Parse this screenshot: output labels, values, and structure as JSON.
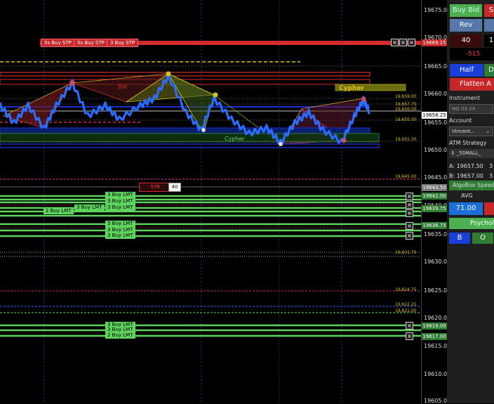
{
  "axis": {
    "ticks": [
      "19675.00",
      "19670.00",
      "19665.00",
      "19660.00",
      "19655.00",
      "19650.00",
      "19645.00",
      "19640.00",
      "19635.00",
      "19630.00",
      "19625.00",
      "19620.00",
      "19615.00",
      "19610.00",
      "19605.00"
    ],
    "price_tags": [
      {
        "label": "19669.25",
        "color": "#c8282c"
      },
      {
        "label": "19658.25",
        "color": "#ffffff"
      },
      {
        "label": "19643.50",
        "color": "#777777"
      },
      {
        "label": "19642.00",
        "color": "#2e7d32"
      },
      {
        "label": "19639.75",
        "color": "#2e7d32"
      },
      {
        "label": "19636.75",
        "color": "#2e7d32"
      },
      {
        "label": "19619.00",
        "color": "#2e7d32"
      },
      {
        "label": "19617.00",
        "color": "#2e7d32"
      }
    ]
  },
  "chart": {
    "stop_orders": [
      "5s Buy STP",
      "5s Buy STP",
      "3 Buy STP"
    ],
    "limit_orders_a": [
      "3 Buy LMT",
      "3 Buy LMT",
      "3 Buy LMT"
    ],
    "limit_orders_b": [
      "2 Buy LMT",
      "3 Buy LMT"
    ],
    "limit_orders_c": [
      "3 Buy LMT",
      "3 Buy LMT",
      "3 Buy LMT"
    ],
    "limit_orders_d": [
      "3 Buy LMT",
      "3 Buy LMT",
      "2 Buy LMT"
    ],
    "pattern_labels": [
      "Cypher",
      "Cypher",
      "Bat"
    ],
    "level_labels": [
      "19,659.00",
      "19,657.75",
      "19,656.00",
      "19,655.00",
      "19,651.50",
      "19,645.00",
      "19,631.75",
      "19,624.75",
      "19,622.25",
      "19,621.00"
    ],
    "pnl": "-576",
    "pnl_qty": "40"
  },
  "panel": {
    "buy_bid": "Buy Bid",
    "sell": "S",
    "rev": "Rev",
    "qty": "40",
    "qty2": "1",
    "pnl": "-515",
    "half": "Half",
    "d": "D",
    "flatten": "Flatten A",
    "instrument_label": "Instrument",
    "instrument_value": "NQ 03-24",
    "account_label": "Account",
    "account_value": "Vincent...",
    "atm_label": "ATM Strategy",
    "atm_value": "_5SMALL_",
    "ask": "A: 19657.50",
    "ask_qty": "3",
    "bid": "B: 19657.00",
    "bid_qty": "3",
    "algobox": "AlgoBox Speed",
    "avg_label": "AVG",
    "avg_value": "71.00",
    "psych": "Psycholo",
    "btn_b": "B",
    "btn_o": "O"
  }
}
